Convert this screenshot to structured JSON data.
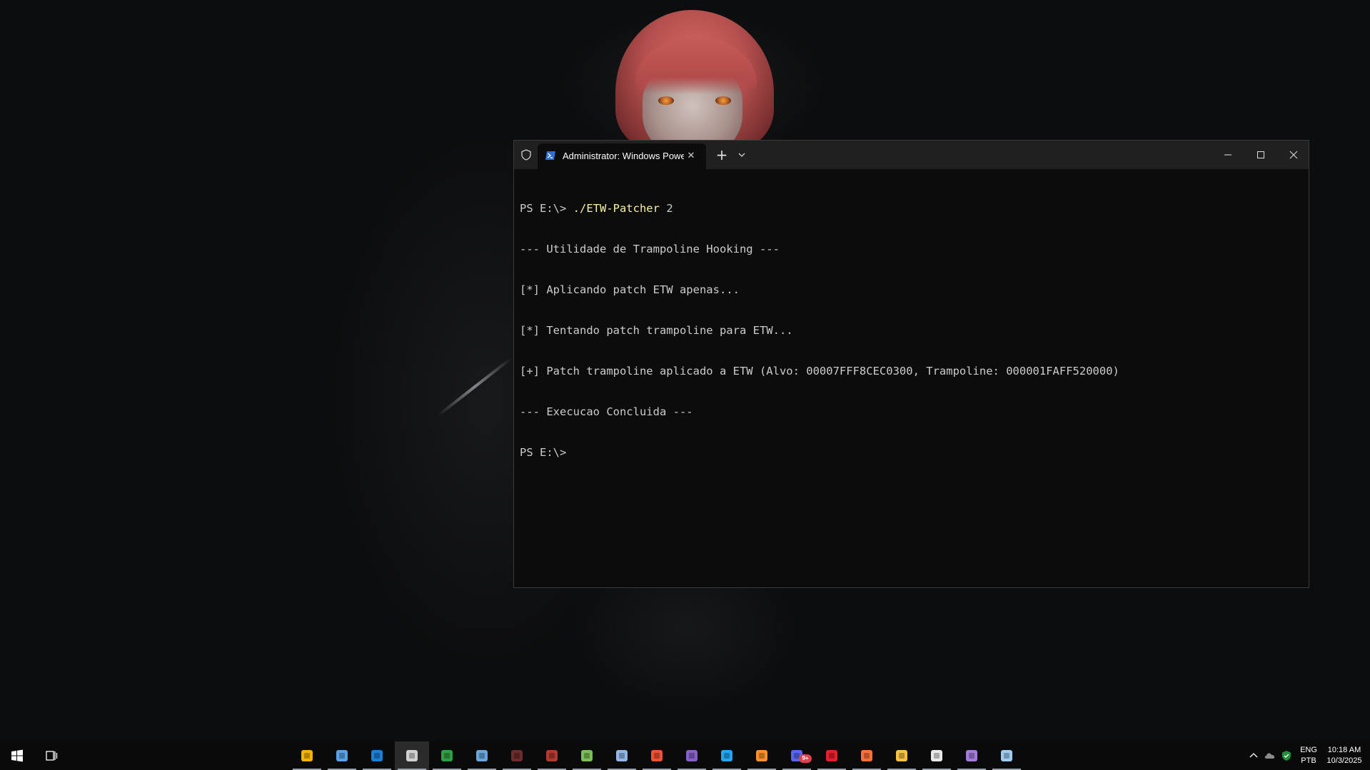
{
  "terminal": {
    "tab_title": "Administrator: Windows Powe",
    "lines": [
      {
        "prompt": "PS E:\\> ",
        "command": "./ETW-Patcher",
        "args": " 2"
      },
      {
        "text": "--- Utilidade de Trampoline Hooking ---"
      },
      {
        "text": "[*] Aplicando patch ETW apenas..."
      },
      {
        "text": "[*] Tentando patch trampoline para ETW..."
      },
      {
        "text": "[+] Patch trampoline aplicado a ETW (Alvo: 00007FFF8CEC0300, Trampoline: 000001FAFF520000)"
      },
      {
        "text": "--- Execucao Concluida ---"
      },
      {
        "text": "PS E:\\> "
      }
    ],
    "colors": {
      "background": "#0c0c0c",
      "foreground": "#cccccc",
      "command": "#f9f1a5",
      "titlebar": "#202020"
    }
  },
  "window_controls": {
    "minimize": "minimize-icon",
    "maximize": "maximize-icon",
    "close": "close-icon"
  },
  "taskbar": {
    "start_icon": "windows-logo-icon",
    "task_view_icon": "task-view-icon",
    "apps": [
      {
        "name": "linux-penguin-app-icon",
        "color": "#f2b400"
      },
      {
        "name": "notepad-app-icon",
        "color": "#5aa0e6"
      },
      {
        "name": "shield-app-icon",
        "color": "#1c7fd6"
      },
      {
        "name": "terminal-app-icon",
        "color": "#d0d0d0",
        "active": true
      },
      {
        "name": "spreadsheet-app-icon",
        "color": "#2ea043"
      },
      {
        "name": "monitor-app-icon",
        "color": "#6aa6d8"
      },
      {
        "name": "bug-app-icon",
        "color": "#6c2c2c"
      },
      {
        "name": "character-app-icon",
        "color": "#b03a2e"
      },
      {
        "name": "magnifier-app-icon",
        "color": "#7cbf5a"
      },
      {
        "name": "defender-app-icon",
        "color": "#8fb7e6"
      },
      {
        "name": "git-app-icon",
        "color": "#f05033"
      },
      {
        "name": "visual-studio-app-icon",
        "color": "#8661c5"
      },
      {
        "name": "vscode-app-icon",
        "color": "#23a6f2"
      },
      {
        "name": "search-app-icon",
        "color": "#f7902a"
      },
      {
        "name": "chat-app-icon",
        "color": "#5865f2",
        "badge": "9+"
      },
      {
        "name": "opera-app-icon",
        "color": "#e4202c"
      },
      {
        "name": "firefox-app-icon",
        "color": "#ff7139"
      },
      {
        "name": "file-explorer-app-icon",
        "color": "#f5c242"
      },
      {
        "name": "security-app-icon",
        "color": "#e8e8e8"
      },
      {
        "name": "visual-studio-preview-app-icon",
        "color": "#a57bd8"
      },
      {
        "name": "paint-app-icon",
        "color": "#9ecbf0"
      }
    ],
    "tray": {
      "chevron_icon": "chevron-up-icon",
      "cloud_icon": "cloud-icon",
      "security_icon": "security-check-icon",
      "lang_top": "ENG",
      "lang_bottom": "PTB",
      "time": "10:18 AM",
      "date": "10/3/2025"
    }
  }
}
